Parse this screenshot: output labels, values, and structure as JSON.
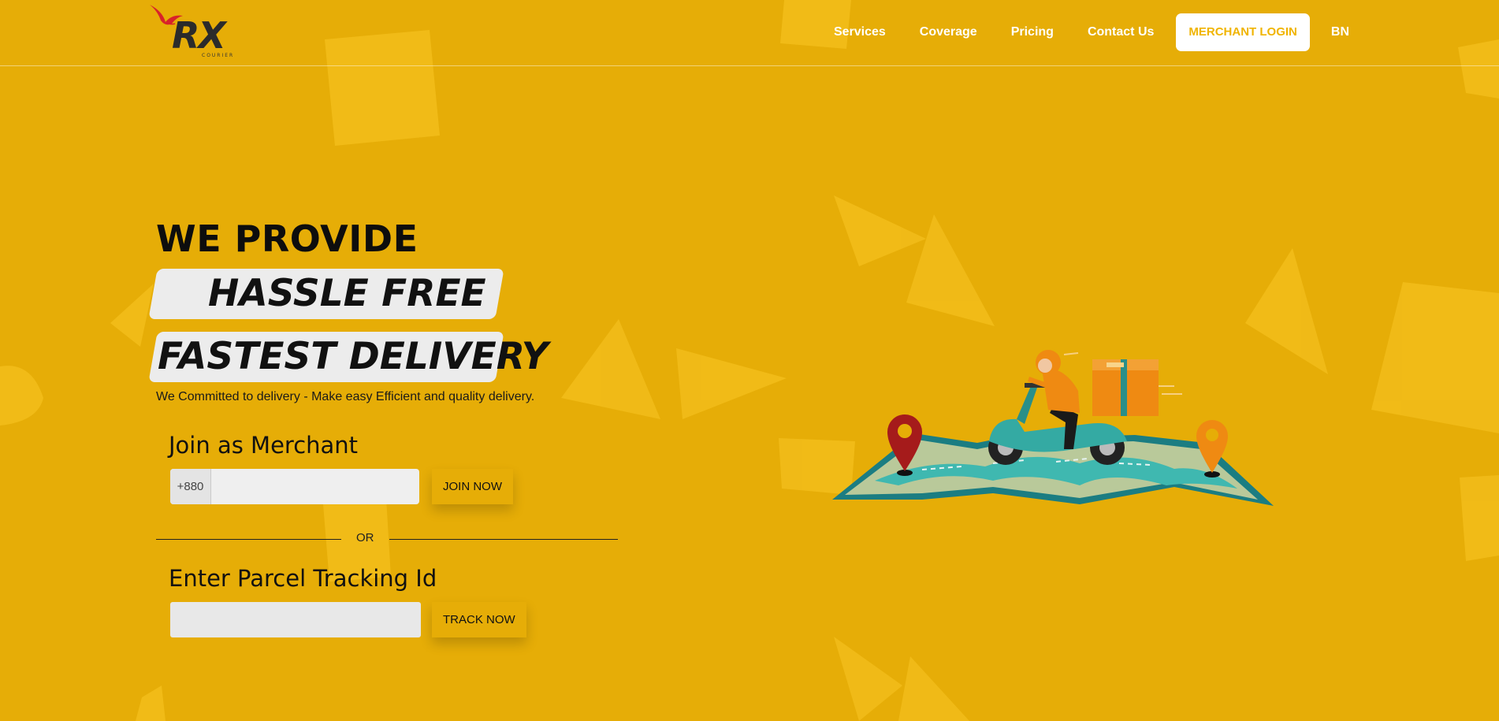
{
  "brand": {
    "name": "RX",
    "subtitle": "COURIER"
  },
  "nav": {
    "items": [
      "Services",
      "Coverage",
      "Pricing",
      "Contact Us"
    ],
    "login_label": "MERCHANT LOGIN",
    "language_label": "BN"
  },
  "hero": {
    "heading": "WE PROVIDE",
    "highlight_1": "HASSLE FREE",
    "highlight_2": "FASTEST DELIVERY",
    "tagline": "We Committed to delivery - Make easy Efficient and quality delivery."
  },
  "merchant": {
    "title": "Join as Merchant",
    "phone_prefix": "+880",
    "phone_value": "",
    "join_label": "JOIN NOW"
  },
  "divider": {
    "label": "OR"
  },
  "tracking": {
    "title": "Enter Parcel Tracking Id",
    "input_value": "",
    "track_label": "TRACK NOW"
  },
  "colors": {
    "background": "#e6ad07",
    "accent": "#f0b400",
    "highlight_box": "#ececec",
    "logo_x": "#d8222a"
  },
  "icons": {
    "logo_mark": "bird-icon",
    "illustration": "delivery-scooter-map-illustration"
  }
}
